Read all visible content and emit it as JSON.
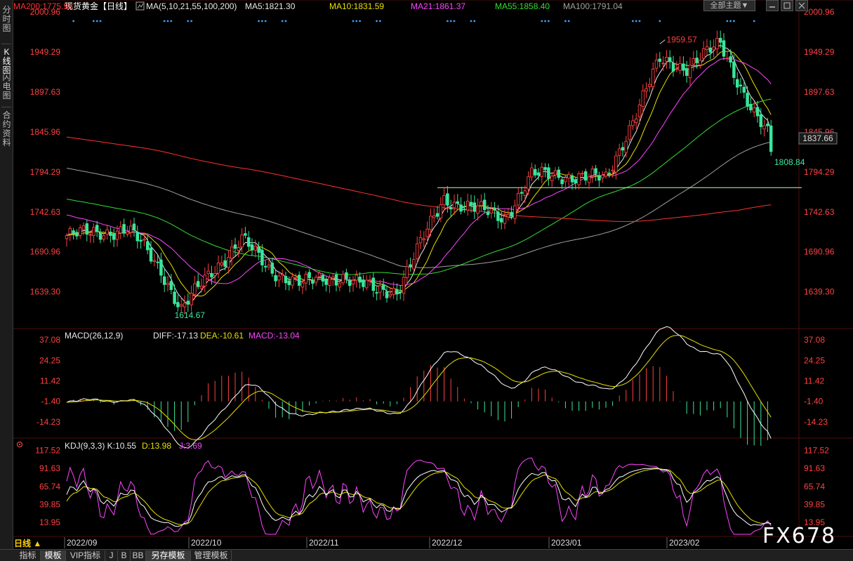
{
  "sidebar": {
    "items": [
      "分时图",
      "K线图",
      "闪电图",
      "合约资料"
    ]
  },
  "top_controls": {
    "theme_label": "全部主题▼"
  },
  "bottom_tabs": [
    "指标",
    "模板",
    "VIP指标",
    "J",
    "B",
    "BB",
    "另存模板",
    "管理模板"
  ],
  "period": "日线 ▲",
  "watermark": "FX678",
  "colors": {
    "up": "#ff3f3f",
    "down": "#39e69a",
    "ma5": "#e8e8e8",
    "ma10": "#e6e000",
    "ma21": "#ff44ff",
    "ma55": "#33dd33",
    "ma100": "#a0a0a0",
    "ma200": "#ff3030",
    "axis_text": "#ff4040",
    "dea": "#e6e000",
    "macd_line": "#ff44ff"
  },
  "chart_data": [
    {
      "type": "candlestick",
      "name": "现货黄金【日线】",
      "indicator_legend": [
        {
          "label": "MA(5,10,21,55,100,200)",
          "value": "",
          "color": "#e8e8e8"
        },
        {
          "label": "MA5:",
          "value": "1821.30",
          "color": "#e8e8e8"
        },
        {
          "label": "MA10:",
          "value": "1831.59",
          "color": "#e6e000"
        },
        {
          "label": "MA21:",
          "value": "1861.37",
          "color": "#ff44ff"
        },
        {
          "label": "MA55:",
          "value": "1858.40",
          "color": "#33dd33"
        },
        {
          "label": "MA100:",
          "value": "1791.04",
          "color": "#a0a0a0"
        },
        {
          "label": "MA200:",
          "value": "1775.98",
          "color": "#ff3030"
        }
      ],
      "ylim": [
        1600,
        2000.96
      ],
      "y_ticks": [
        "2000.96",
        "1949.29",
        "1897.63",
        "1845.96",
        "1794.29",
        "1742.63",
        "1690.96",
        "1639.30"
      ],
      "x_ticks": [
        "2022/09",
        "2022/10",
        "2022/11",
        "2022/12",
        "2023/01",
        "2023/02"
      ],
      "current_price": "1837.66",
      "annotations": [
        {
          "text": "1959.57",
          "value": 1959.57,
          "at": "high"
        },
        {
          "text": "1614.67",
          "value": 1614.67,
          "at": "low"
        },
        {
          "text": "1808.84",
          "value": 1808.84,
          "at": "last-low"
        }
      ],
      "support_level": 1774
    },
    {
      "type": "bar+line",
      "name": "MACD",
      "indicator_legend": [
        {
          "label": "MACD(26,12,9)",
          "value": "",
          "color": "#e8e8e8"
        },
        {
          "label": "DIFF:",
          "value": "-17.13",
          "color": "#e8e8e8"
        },
        {
          "label": "DEA:",
          "value": "-10.61",
          "color": "#e6e000"
        },
        {
          "label": "MACD:",
          "value": "-13.04",
          "color": "#ff44ff"
        }
      ],
      "ylim": [
        -24,
        42
      ],
      "y_ticks": [
        "37.08",
        "24.25",
        "11.42",
        "-1.40",
        "-14.23"
      ]
    },
    {
      "type": "line",
      "name": "KDJ",
      "indicator_legend": [
        {
          "label": "KDJ(9,3,3)",
          "value": "",
          "color": "#e8e8e8"
        },
        {
          "label": "K:",
          "value": "10.55",
          "color": "#e8e8e8"
        },
        {
          "label": "D:",
          "value": "13.98",
          "color": "#e6e000"
        },
        {
          "label": "J:",
          "value": "3.69",
          "color": "#ff44ff"
        }
      ],
      "ylim": [
        -5,
        130
      ],
      "y_ticks": [
        "117.52",
        "91.63",
        "65.74",
        "39.85",
        "13.95"
      ]
    }
  ]
}
